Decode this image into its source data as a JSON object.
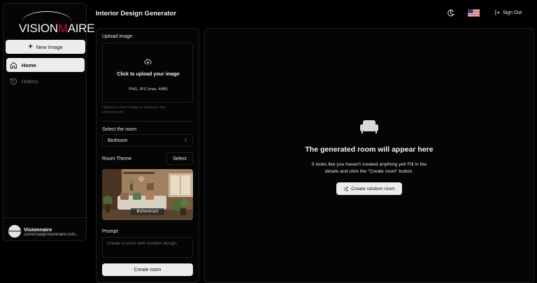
{
  "brand": {
    "logo_text_pre": "VISION",
    "logo_text_accent": "M",
    "logo_text_post": "AIRE",
    "accent_color": "#c8102e"
  },
  "sidebar": {
    "new_image_label": "New Image",
    "items": [
      {
        "label": "Home",
        "icon": "home-icon",
        "active": true
      },
      {
        "label": "History",
        "icon": "history-icon",
        "active": false
      }
    ],
    "user": {
      "name": "Visionnaire",
      "email": "comercial@visionnaire.com...",
      "avatar_text": "VISIONNAIRE"
    }
  },
  "header": {
    "title": "Interior Design Generator",
    "theme_icon": "moon-sun-icon",
    "language_flag": "us-flag-icon",
    "signout_label": "Sign Out"
  },
  "form": {
    "upload_label": "Upload image",
    "upload_title": "Click to upload your image",
    "upload_formats": "PNG, JPG (max. 4MB)",
    "upload_hint": "Upload a room image to enhance the environment",
    "room_label": "Select the room",
    "room_value": "Bedroom",
    "theme_label": "Room Theme",
    "theme_select_label": "Select",
    "theme_name": "Bohemian",
    "prompt_label": "Prompt",
    "prompt_placeholder": "Create a room with modern design",
    "create_label": "Create room"
  },
  "result": {
    "icon": "sofa-icon",
    "empty_title": "The generated room will appear here",
    "empty_desc": "It looks like you haven't created anything yet! Fill in the details and click the \"Create room\" button.",
    "random_label": "Create random room"
  }
}
